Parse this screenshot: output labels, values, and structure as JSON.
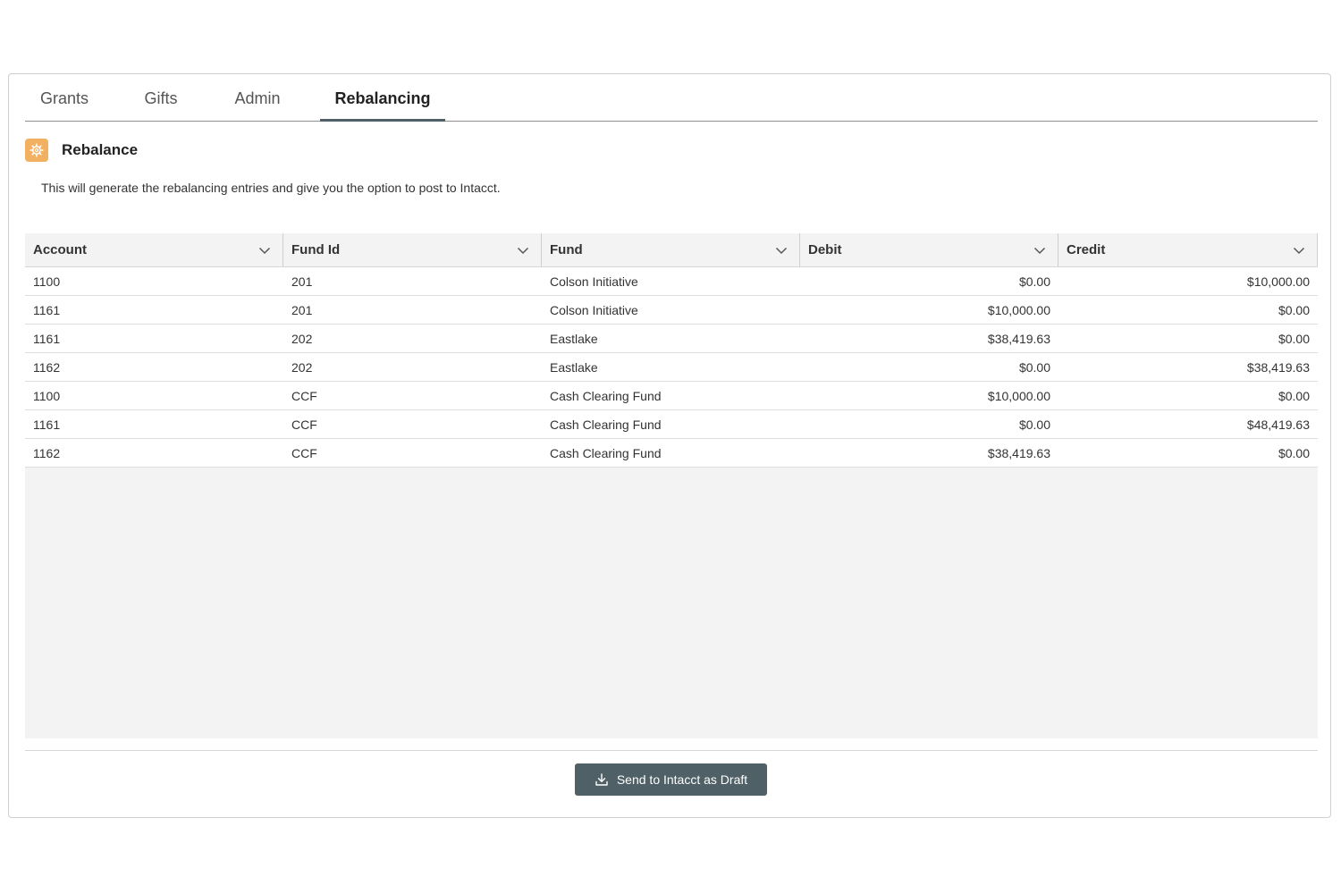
{
  "tabs": [
    {
      "label": "Grants",
      "active": false
    },
    {
      "label": "Gifts",
      "active": false
    },
    {
      "label": "Admin",
      "active": false
    },
    {
      "label": "Rebalancing",
      "active": true
    }
  ],
  "section": {
    "title": "Rebalance",
    "icon": "gear-icon",
    "description": "This will generate the rebalancing entries and give you the option to post to Intacct."
  },
  "table": {
    "columns": [
      "Account",
      "Fund Id",
      "Fund",
      "Debit",
      "Credit"
    ],
    "rows": [
      [
        "1100",
        "201",
        "Colson Initiative",
        "$0.00",
        "$10,000.00"
      ],
      [
        "1161",
        "201",
        "Colson Initiative",
        "$10,000.00",
        "$0.00"
      ],
      [
        "1161",
        "202",
        "Eastlake",
        "$38,419.63",
        "$0.00"
      ],
      [
        "1162",
        "202",
        "Eastlake",
        "$0.00",
        "$38,419.63"
      ],
      [
        "1100",
        "CCF",
        "Cash Clearing Fund",
        "$10,000.00",
        "$0.00"
      ],
      [
        "1161",
        "CCF",
        "Cash Clearing Fund",
        "$0.00",
        "$48,419.63"
      ],
      [
        "1162",
        "CCF",
        "Cash Clearing Fund",
        "$38,419.63",
        "$0.00"
      ]
    ]
  },
  "actions": {
    "send_label": "Send to Intacct as Draft",
    "send_icon": "download-icon"
  },
  "colors": {
    "accent": "#4f6066",
    "icon_bg": "#f1b161",
    "grid_bg": "#f3f3f3"
  }
}
